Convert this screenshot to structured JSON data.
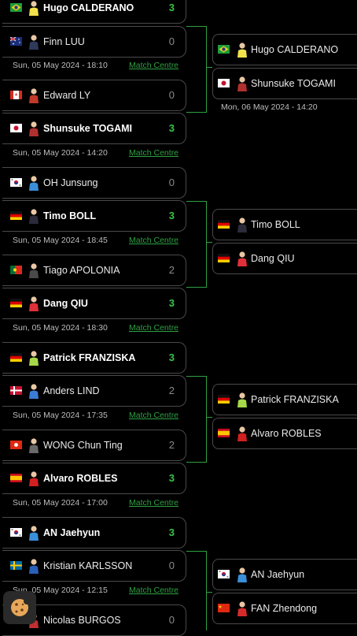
{
  "round1": {
    "cards": [
      {
        "name": "Hugo CALDERANO",
        "score": "3",
        "winner": true,
        "flag": "br"
      },
      {
        "name": "Finn LUU",
        "score": "0",
        "winner": false,
        "flag": "au"
      },
      {
        "name": "Edward LY",
        "score": "0",
        "winner": false,
        "flag": "ca"
      },
      {
        "name": "Shunsuke TOGAMI",
        "score": "3",
        "winner": true,
        "flag": "jp"
      },
      {
        "name": "OH Junsung",
        "score": "0",
        "winner": false,
        "flag": "kr"
      },
      {
        "name": "Timo BOLL",
        "score": "3",
        "winner": true,
        "flag": "de"
      },
      {
        "name": "Tiago APOLONIA",
        "score": "2",
        "winner": false,
        "flag": "pt"
      },
      {
        "name": "Dang QIU",
        "score": "3",
        "winner": true,
        "flag": "de"
      },
      {
        "name": "Patrick FRANZISKA",
        "score": "3",
        "winner": true,
        "flag": "de"
      },
      {
        "name": "Anders LIND",
        "score": "2",
        "winner": false,
        "flag": "dk"
      },
      {
        "name": "WONG Chun Ting",
        "score": "2",
        "winner": false,
        "flag": "hk"
      },
      {
        "name": "Alvaro ROBLES",
        "score": "3",
        "winner": true,
        "flag": "es"
      },
      {
        "name": "AN Jaehyun",
        "score": "3",
        "winner": true,
        "flag": "kr"
      },
      {
        "name": "Kristian KARLSSON",
        "score": "0",
        "winner": false,
        "flag": "se"
      },
      {
        "name": "Nicolas BURGOS",
        "score": "0",
        "winner": false,
        "flag": "cl"
      }
    ],
    "meta": [
      {
        "date": "Sun, 05 May 2024 - 18:10",
        "link": "Match Centre"
      },
      {
        "date": "Sun, 05 May 2024 - 14:20",
        "link": "Match Centre"
      },
      {
        "date": "Sun, 05 May 2024 - 18:45",
        "link": "Match Centre"
      },
      {
        "date": "Sun, 05 May 2024 - 18:30",
        "link": "Match Centre"
      },
      {
        "date": "Sun, 05 May 2024 - 17:35",
        "link": "Match Centre"
      },
      {
        "date": "Sun, 05 May 2024 - 17:00",
        "link": "Match Centre"
      },
      {
        "date": "Sun, 05 May 2024 - 12:15",
        "link": "Match Centre"
      }
    ]
  },
  "round2": {
    "cards": [
      {
        "name": "Hugo CALDERANO",
        "flag": "br"
      },
      {
        "name": "Shunsuke TOGAMI",
        "flag": "jp"
      },
      {
        "name": "Timo BOLL",
        "flag": "de"
      },
      {
        "name": "Dang QIU",
        "flag": "de"
      },
      {
        "name": "Patrick FRANZISKA",
        "flag": "de"
      },
      {
        "name": "Alvaro ROBLES",
        "flag": "es"
      },
      {
        "name": "AN Jaehyun",
        "flag": "kr"
      },
      {
        "name": "FAN Zhendong",
        "flag": "cn"
      }
    ],
    "dates": [
      "Mon, 06 May 2024 - 14:20"
    ]
  },
  "cookie": {
    "icon": "cookie-icon"
  },
  "colors": {
    "accent": "#2ea043",
    "win_score": "#39c24a",
    "bg": "#000000",
    "border": "#4a4a4a"
  }
}
